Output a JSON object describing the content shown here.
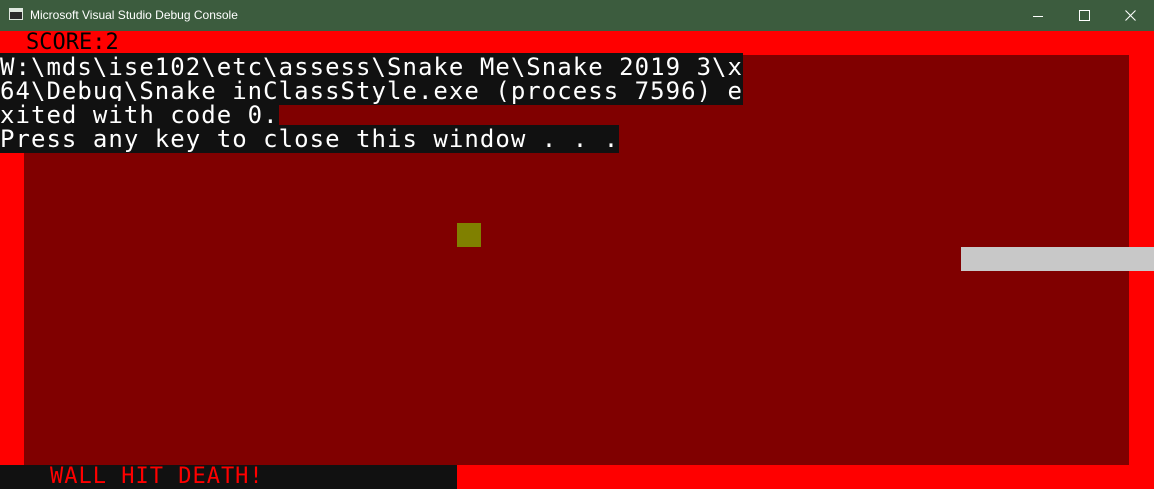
{
  "window": {
    "title": "Microsoft Visual Studio Debug Console",
    "icon": "console-app-icon"
  },
  "controls": {
    "minimize_icon": "minimize-icon",
    "maximize_icon": "maximize-icon",
    "close_icon": "close-icon"
  },
  "game": {
    "score_label": "SCORE:2",
    "status_message": "WALL HIT DEATH!",
    "colors": {
      "border": "#ff0000",
      "field": "#800000",
      "food": "#808000",
      "snake": "#c8c8c8",
      "score_text": "#000000",
      "status_text": "#ff0000"
    }
  },
  "console_output": {
    "lines": [
      "W:\\mds\\ise102\\etc\\assess\\Snake_Me\\Snake_2019_3\\x",
      "64\\Debug\\Snake_inClassStyle.exe (process 7596) e",
      "xited with code 0.",
      "Press any key to close this window . . ."
    ]
  }
}
